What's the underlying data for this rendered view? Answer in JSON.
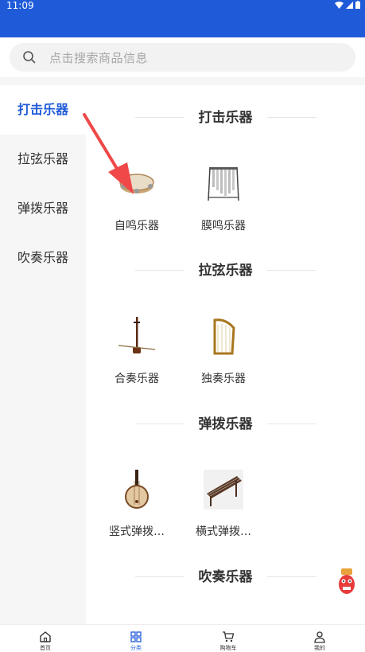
{
  "status": {
    "time": "11:09"
  },
  "search": {
    "placeholder": "点击搜索商品信息"
  },
  "sidebar": {
    "items": [
      {
        "label": "打击乐器",
        "active": true
      },
      {
        "label": "拉弦乐器",
        "active": false
      },
      {
        "label": "弹拨乐器",
        "active": false
      },
      {
        "label": "吹奏乐器",
        "active": false
      }
    ]
  },
  "sections": [
    {
      "title": "打击乐器",
      "items": [
        {
          "label": "自鸣乐器",
          "icon": "tambourine-icon"
        },
        {
          "label": "膜鸣乐器",
          "icon": "chimes-icon"
        }
      ]
    },
    {
      "title": "拉弦乐器",
      "items": [
        {
          "label": "合奏乐器",
          "icon": "erhu-icon"
        },
        {
          "label": "独奏乐器",
          "icon": "harp-icon"
        }
      ]
    },
    {
      "title": "弹拨乐器",
      "items": [
        {
          "label": "竖式弹拨…",
          "icon": "pipa-icon"
        },
        {
          "label": "横式弹拨…",
          "icon": "guzheng-icon"
        }
      ]
    },
    {
      "title": "吹奏乐器",
      "items": []
    }
  ],
  "tabbar": {
    "items": [
      {
        "label": "首页",
        "icon": "home-icon",
        "active": false
      },
      {
        "label": "分类",
        "icon": "category-icon",
        "active": true
      },
      {
        "label": "购物车",
        "icon": "cart-icon",
        "active": false
      },
      {
        "label": "我的",
        "icon": "user-icon",
        "active": false
      }
    ]
  },
  "colors": {
    "accent": "#1f5bd8",
    "sidebar_bg": "#f6f6f6",
    "annotation_arrow": "#f04848"
  }
}
